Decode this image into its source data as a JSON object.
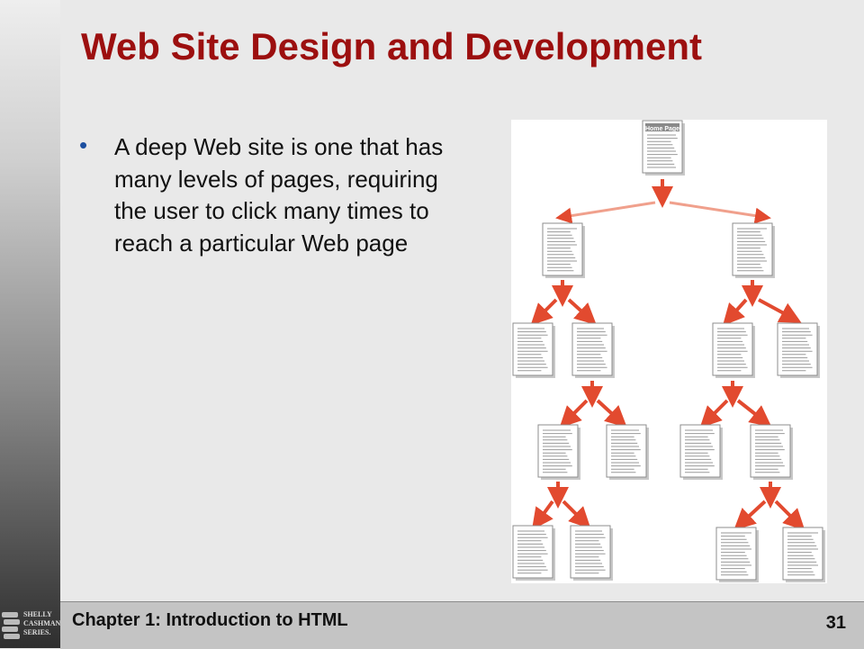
{
  "slide": {
    "title": "Web Site Design and Development",
    "bullet": "A deep Web site is one that has many levels of pages, requiring the user to click many times to reach a particular Web page"
  },
  "diagram": {
    "root_label": "Home Page"
  },
  "footer": {
    "chapter": "Chapter 1: Introduction to HTML",
    "page_number": "31"
  },
  "logo": {
    "lines": [
      "SHELLY",
      "CASHMAN",
      "SERIES."
    ]
  },
  "colors": {
    "title": "#9c0f0f",
    "bullet": "#1c4fa0",
    "arrow": "#e24a2f"
  }
}
